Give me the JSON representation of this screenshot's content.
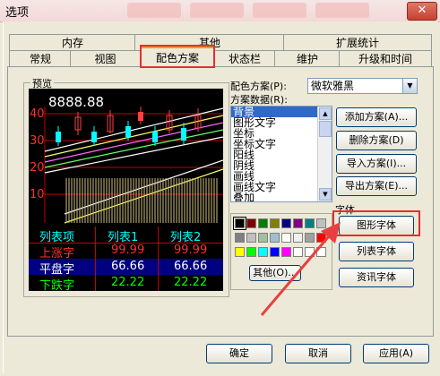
{
  "window": {
    "title": "选项",
    "close_label": "✕"
  },
  "tabs_back": [
    "内存",
    "其他",
    "扩展统计"
  ],
  "tabs_front": [
    "常规",
    "视图",
    "配色方案",
    "状态栏",
    "维护",
    "升级和时间"
  ],
  "preview": {
    "label": "预览",
    "price": "8888.88",
    "axis": [
      "40",
      "30",
      "20",
      "10"
    ],
    "table": {
      "headers": [
        "列表项",
        "列表1",
        "列表2"
      ],
      "rows": [
        {
          "label": "上涨字",
          "v1": "99.99",
          "v2": "99.99"
        },
        {
          "label": "平盘字",
          "v1": "66.66",
          "v2": "66.66"
        },
        {
          "label": "下跌字",
          "v1": "22.22",
          "v2": "22.22"
        }
      ]
    }
  },
  "scheme": {
    "label": "配色方案(P):",
    "value": "微软雅黑"
  },
  "scheme_data": {
    "label": "方案数据(R):",
    "items": [
      "背景",
      "图形文字",
      "坐标",
      "坐标文字",
      "阳线",
      "阴线",
      "画线",
      "画线文字",
      "叠加"
    ]
  },
  "buttons": {
    "add": "添加方案(A)...",
    "delete": "删除方案(D)",
    "import": "导入方案(I)...",
    "export": "导出方案(E)...",
    "other": "其他(O)...",
    "graph_font": "图形字体",
    "list_font": "列表字体",
    "info_font": "资讯字体",
    "ok": "确定",
    "cancel": "取消",
    "apply": "应用(A)"
  },
  "font_group": {
    "label": "字体"
  },
  "colors": {
    "accent_red": "#e03030",
    "palette_row1": [
      "#000000",
      "#800000",
      "#008000",
      "#808000",
      "#000080",
      "#800080",
      "#008080",
      "#c0c0c0"
    ],
    "palette_row2": [
      "#808080",
      "#c0c0c0",
      "#a0c0a0",
      "#a0c0d0",
      "#ffffff",
      "#f0f0f0",
      "#a0a0a0",
      "#ff0000"
    ],
    "palette_row3": [
      "#ffff00",
      "#00ff00",
      "#00ffff",
      "#0000ff",
      "#ff00ff",
      "#ffffff",
      "#ffffff",
      "#ffffff"
    ]
  }
}
